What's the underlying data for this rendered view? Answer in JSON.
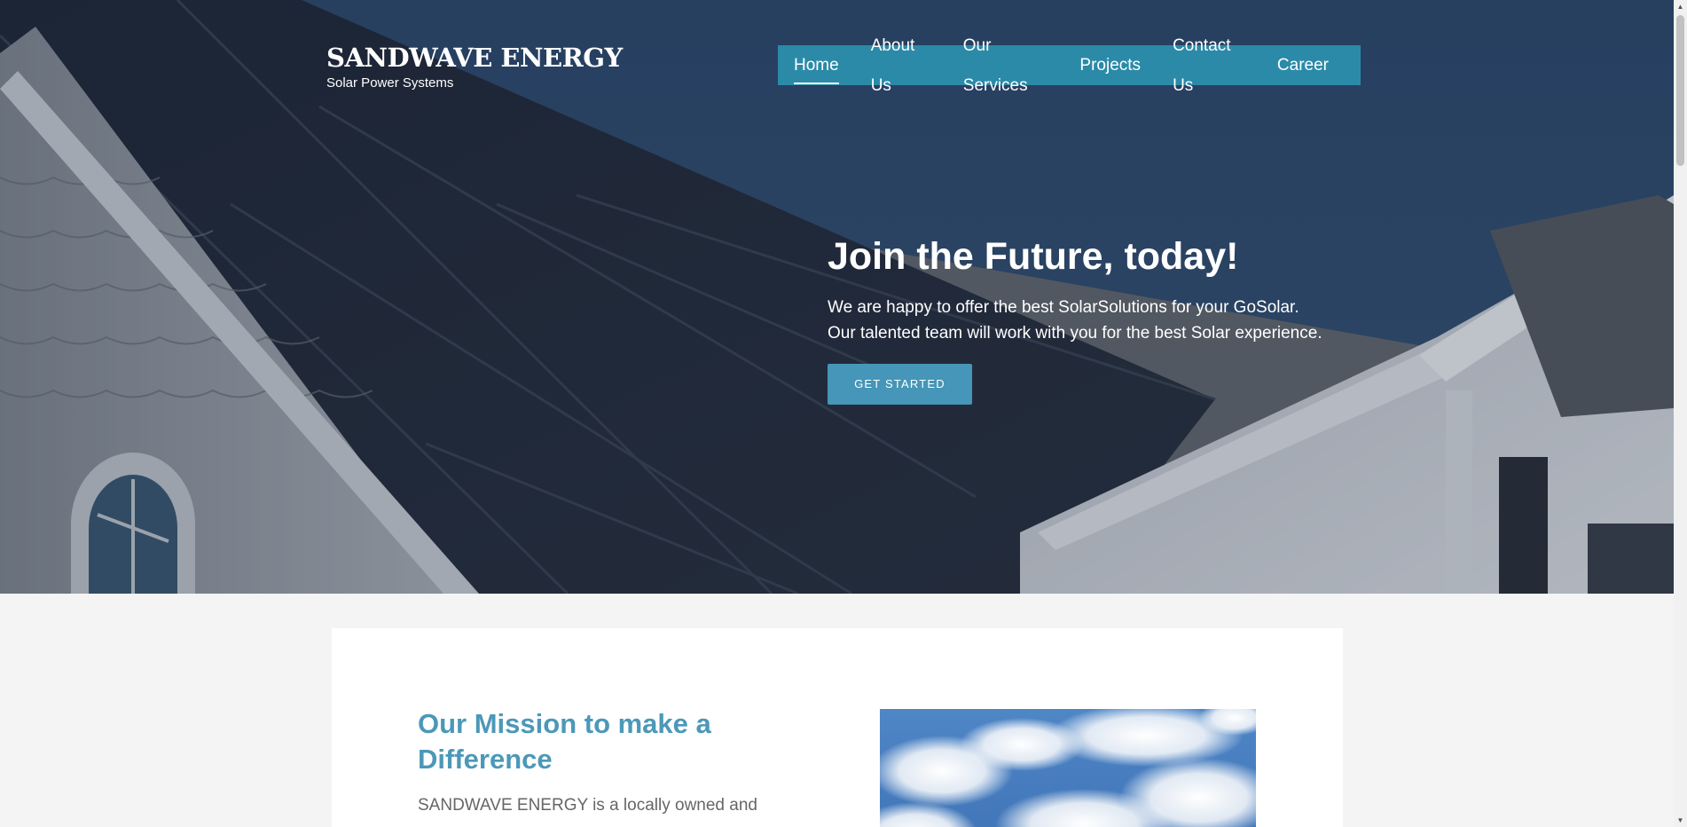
{
  "brand": {
    "title": "SANDWAVE ENERGY",
    "tagline": "Solar Power Systems"
  },
  "nav": {
    "items": [
      {
        "label": "Home",
        "active": true
      },
      {
        "label": "About Us",
        "active": false
      },
      {
        "label": "Our Services",
        "active": false
      },
      {
        "label": "Projects",
        "active": false
      },
      {
        "label": "Contact Us",
        "active": false
      },
      {
        "label": "Career",
        "active": false
      }
    ]
  },
  "hero": {
    "heading": "Join the Future, today!",
    "subtext": "We are happy to offer the best SolarSolutions for your GoSolar. Our talented team will work with you for the best Solar experience.",
    "cta_label": "GET STARTED"
  },
  "mission": {
    "heading": "Our Mission to make a Difference",
    "text": "SANDWAVE ENERGY is a locally owned and"
  },
  "colors": {
    "nav_bg": "#2b8aa8",
    "cta_bg": "#4596b8",
    "mission_heading": "#4c98b8",
    "page_bg": "#f4f4f4"
  }
}
